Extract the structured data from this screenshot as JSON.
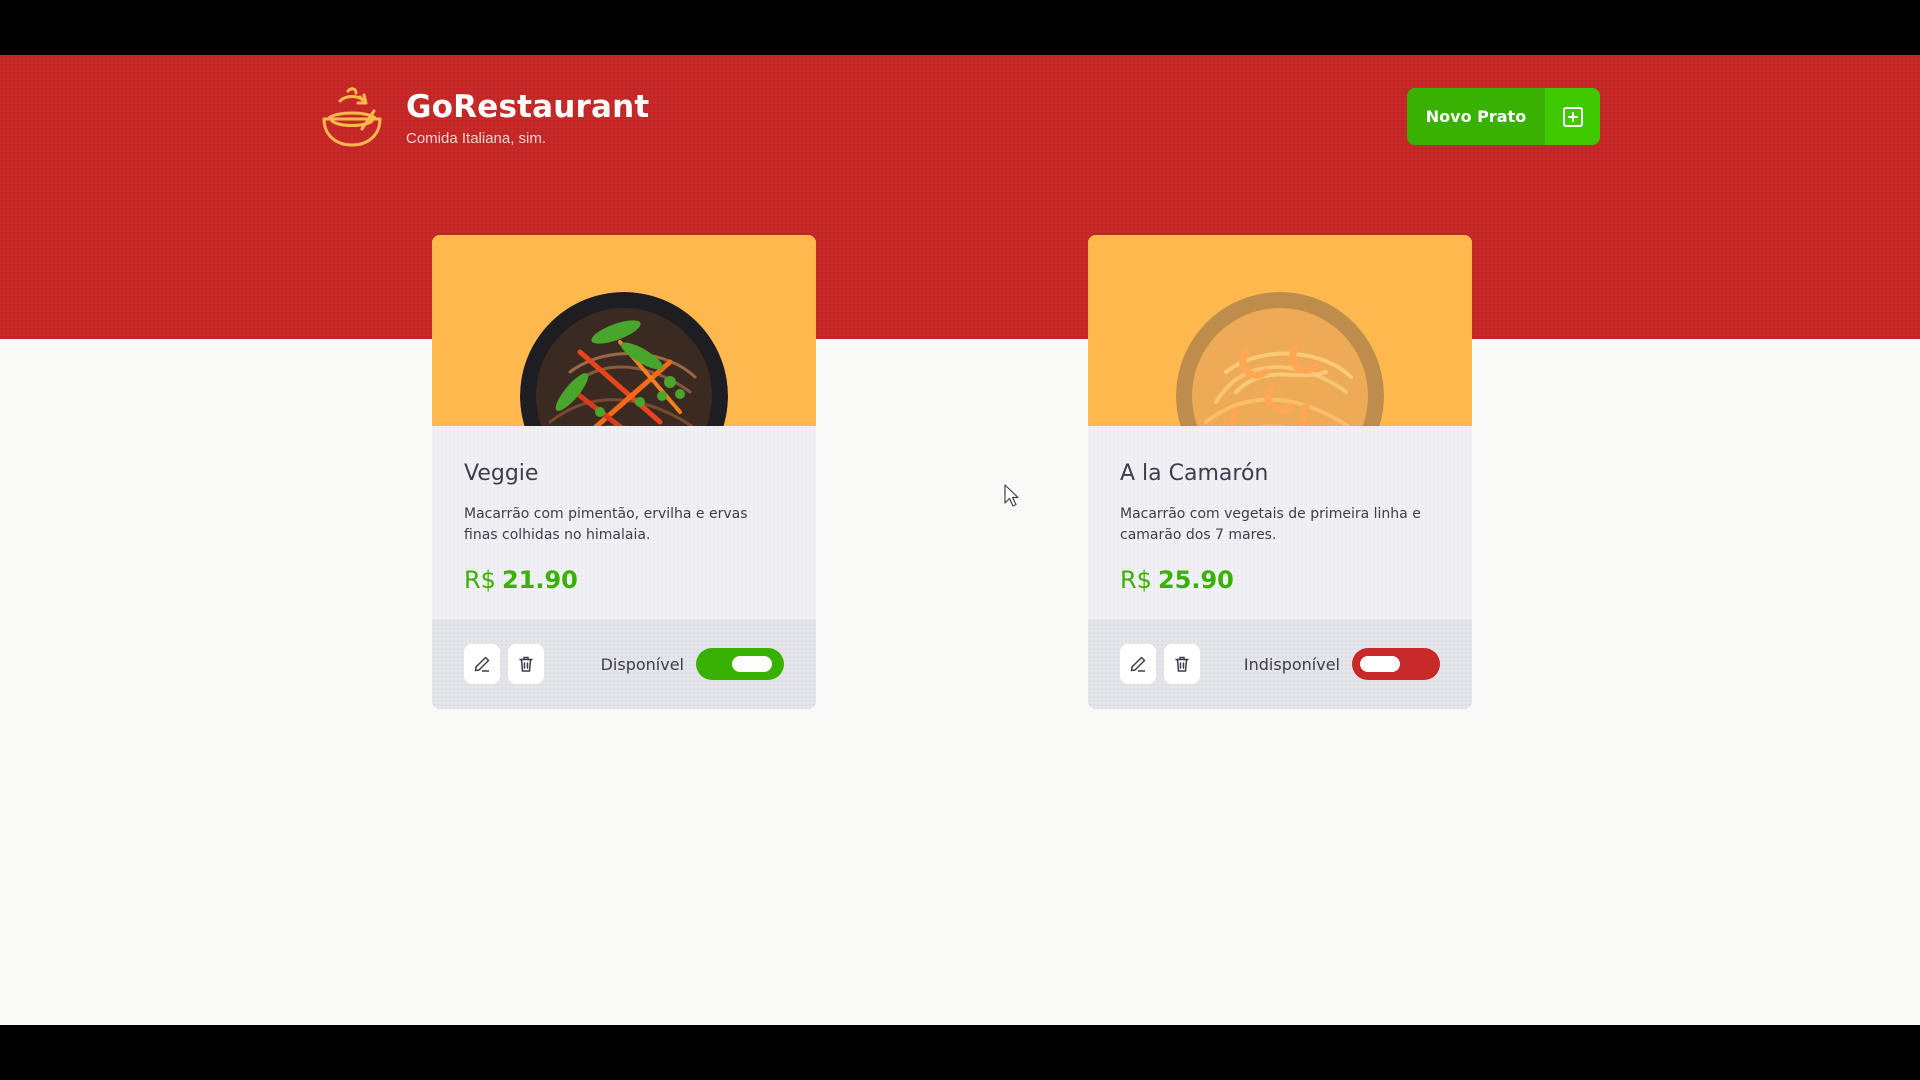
{
  "header": {
    "title": "GoRestaurant",
    "subtitle": "Comida Italiana, sim.",
    "new_button_label": "Novo Prato",
    "new_button_icon": "plus-square-icon",
    "logo_icon": "bowl-icon",
    "colors": {
      "primary": "#c72828",
      "accent": "#ffb84d",
      "success": "#39b100"
    }
  },
  "foods": [
    {
      "name": "Veggie",
      "description": "Macarrão com pimentão, ervilha e ervas finas colhidas no himalaia.",
      "currency": "R$",
      "price": "21.90",
      "availability_label": "Disponível",
      "available": true
    },
    {
      "name": "A la Camarón",
      "description": "Macarrão com vegetais de primeira linha e camarão dos 7 mares.",
      "currency": "R$",
      "price": "25.90",
      "availability_label": "Indisponível",
      "available": false
    }
  ]
}
